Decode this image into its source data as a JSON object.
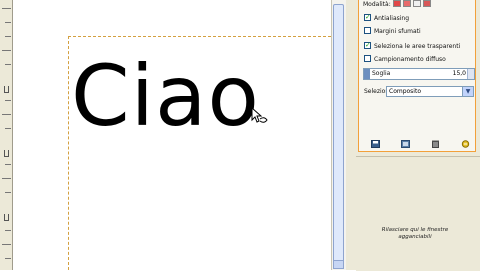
{
  "canvas": {
    "text": "Ciao",
    "cursor_icon": "text-cursor-icon"
  },
  "tool_options": {
    "mode_label": "Modalità:",
    "options": [
      {
        "label": "Antialiasing",
        "checked": true
      },
      {
        "label": "Margini sfumati",
        "checked": false
      },
      {
        "label": "Seleziona le aree trasparenti",
        "checked": true
      },
      {
        "label": "Campionamento diffuso",
        "checked": false
      }
    ],
    "threshold_label": "Soglia",
    "threshold_value": "15,0",
    "select_by_label": "Seleziona per:",
    "select_by_value": "Composito",
    "footer_icons": [
      "save-icon",
      "restore-icon",
      "delete-icon",
      "reset-icon"
    ]
  },
  "hint": {
    "text": "Rilasciare qui le finestre agganciabili"
  },
  "colors": {
    "accent": "#f2a03a",
    "guide": "#d4a040",
    "panel_bg": "#ece9d8"
  }
}
